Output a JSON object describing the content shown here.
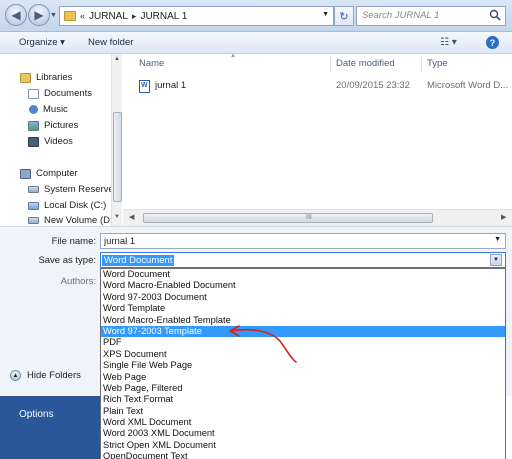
{
  "address_bar": {
    "crumb_prefix": "«",
    "path": [
      "JURNAL",
      "JURNAL 1"
    ],
    "search_placeholder": "Search JURNAL 1"
  },
  "toolbar": {
    "organize_label": "Organize ▾",
    "new_folder_label": "New folder"
  },
  "nav_pane": {
    "items": [
      {
        "label": "Libraries",
        "icon": "libraries-icon"
      },
      {
        "label": "Documents",
        "icon": "documents-icon"
      },
      {
        "label": "Music",
        "icon": "music-icon"
      },
      {
        "label": "Pictures",
        "icon": "pictures-icon"
      },
      {
        "label": "Videos",
        "icon": "videos-icon"
      },
      {
        "label": "Computer",
        "icon": "computer-icon"
      },
      {
        "label": "System Reserved",
        "icon": "drive-icon"
      },
      {
        "label": "Local Disk (C:)",
        "icon": "drive-icon"
      },
      {
        "label": "New Volume (D:)",
        "icon": "drive-icon"
      }
    ]
  },
  "file_list": {
    "columns": [
      "Name",
      "Date modified",
      "Type"
    ],
    "rows": [
      {
        "name": "jurnal 1",
        "date_modified": "20/09/2015 23:32",
        "type": "Microsoft Word D..."
      }
    ],
    "hscroll_grip": "III"
  },
  "form": {
    "file_name_label": "File name:",
    "file_name_value": "jurnal 1",
    "save_as_type_label": "Save as type:",
    "save_as_type_value": "Word Document",
    "authors_label": "Authors:",
    "hide_folders_label": "Hide Folders"
  },
  "type_options": [
    "Word Document",
    "Word Macro-Enabled Document",
    "Word 97-2003 Document",
    "Word Template",
    "Word Macro-Enabled Template",
    "Word 97-2003 Template",
    "PDF",
    "XPS Document",
    "Single File Web Page",
    "Web Page",
    "Web Page, Filtered",
    "Rich Text Format",
    "Plain Text",
    "Word XML Document",
    "Word 2003 XML Document",
    "Strict Open XML Document",
    "OpenDocument Text"
  ],
  "highlighted_option": "Word 97-2003 Template",
  "backstage": {
    "options_label": "Options"
  },
  "colors": {
    "selection": "#3399ff",
    "backstage_blue": "#2a579a",
    "annotation_red": "#d42020"
  }
}
